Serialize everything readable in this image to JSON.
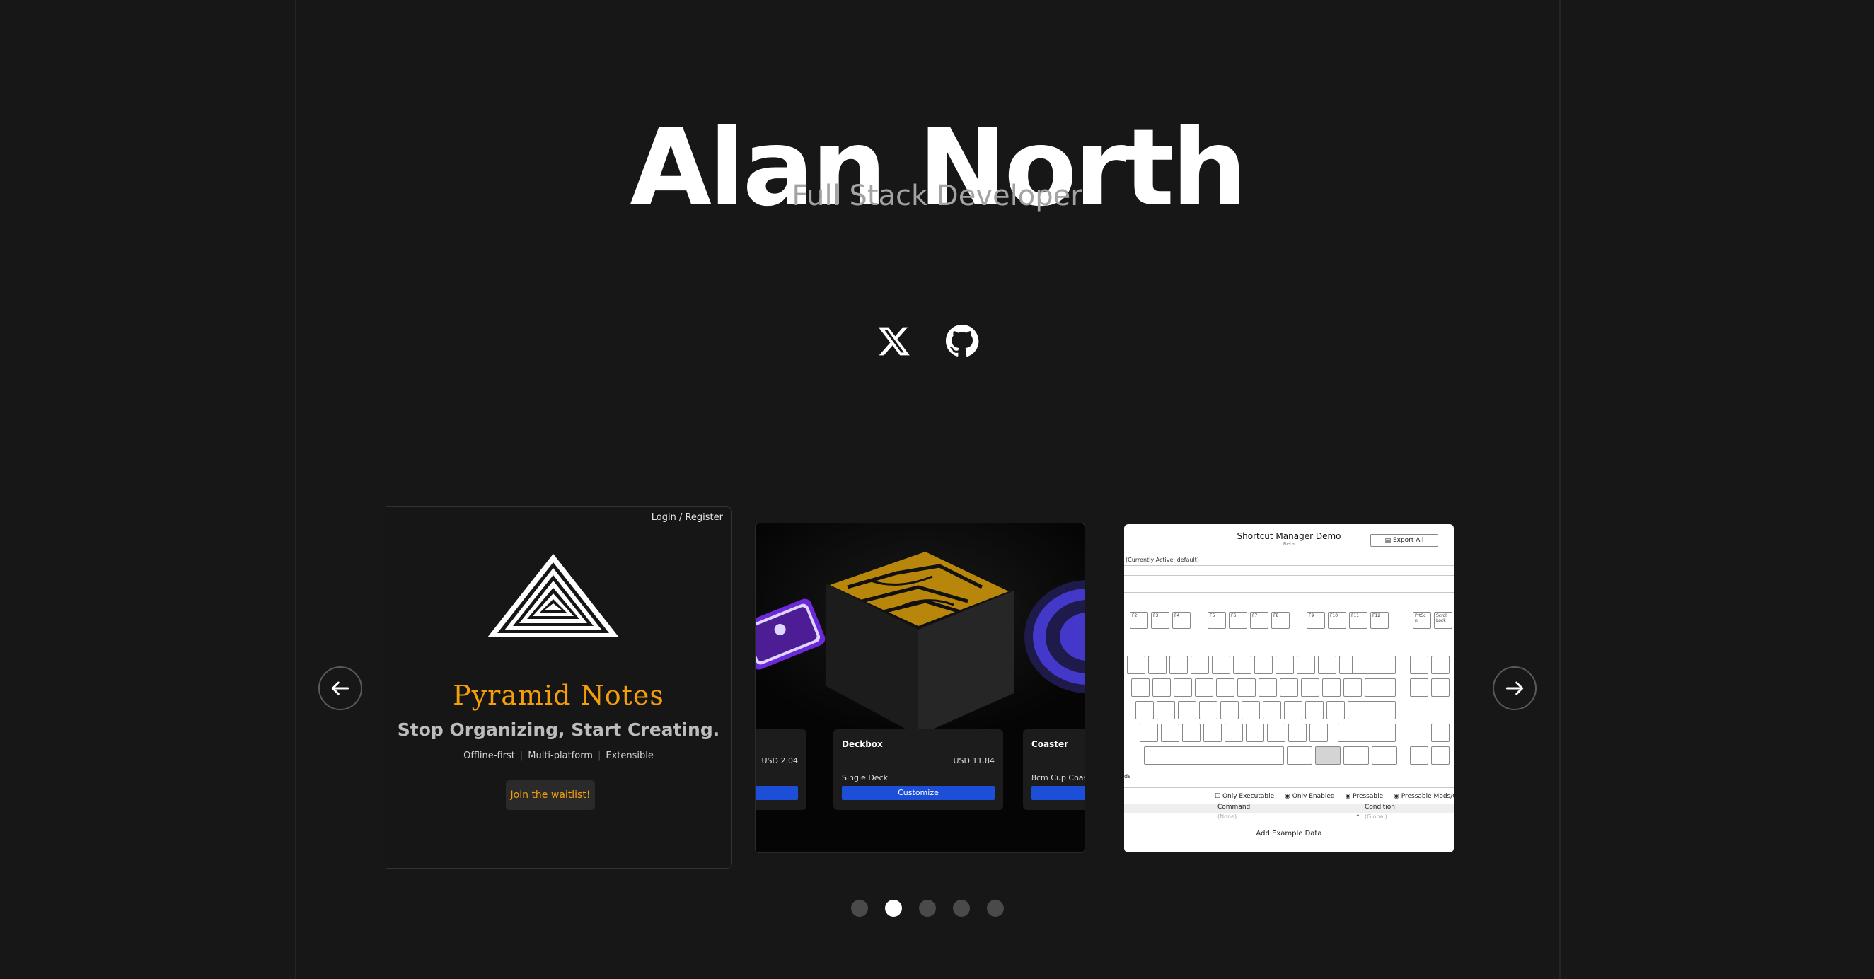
{
  "header": {
    "name": "Alan North",
    "role": "Full Stack Developer"
  },
  "social": [
    {
      "icon": "x-icon"
    },
    {
      "icon": "github-icon"
    }
  ],
  "carousel": {
    "prev_icon": "arrow-left-icon",
    "next_icon": "arrow-right-icon",
    "active_index": 1,
    "dot_count": 5,
    "slides": {
      "pyramid": {
        "login": "Login / Register",
        "brand": "Pyramid Notes",
        "tagline": "Stop Organizing, Start Creating.",
        "features": [
          "Offline-first",
          "Multi-platform",
          "Extensible"
        ],
        "cta": "Join the waitlist!"
      },
      "shop": {
        "products": [
          {
            "name": "",
            "price": "USD 2.04",
            "variant": "",
            "button": ""
          },
          {
            "name": "Deckbox",
            "price": "USD 11.84",
            "variant": "Single Deck",
            "button": "Customize"
          },
          {
            "name": "Coaster",
            "price": "",
            "variant": "8cm Cup Coas",
            "button": ""
          }
        ]
      },
      "shortcuts": {
        "title": "Shortcut Manager Demo",
        "subtitle": "Beta",
        "export": "Export All",
        "active": "(Currently Active: default)",
        "fn_keys": [
          "F2",
          "F3",
          "F4",
          "F5",
          "F6",
          "F7",
          "F8",
          "F9",
          "F10",
          "F11",
          "F12",
          "PrtSc n",
          "Scroll Lock"
        ],
        "filters": [
          "Only Executable",
          "Only Enabled",
          "Pressable",
          "Pressable Mods/Ch"
        ],
        "columns": [
          "Command",
          "Condition"
        ],
        "row": [
          "(None)",
          "(Global)"
        ],
        "add_button": "Add Example Data",
        "partial_label": "ds"
      }
    }
  },
  "colors": {
    "background": "#171717",
    "accent_orange": "#f59e0b",
    "accent_blue": "#1d4ed8",
    "muted_text": "#a3a3a3"
  }
}
